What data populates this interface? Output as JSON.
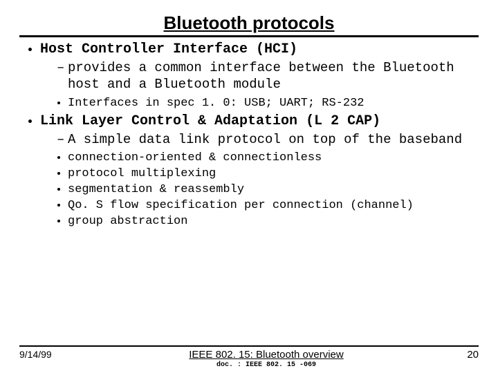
{
  "title": "Bluetooth protocols",
  "sections": [
    {
      "heading": "Host Controller Interface (HCI)",
      "dash": [
        "provides a common interface between the Bluetooth host and a Bluetooth module"
      ],
      "dot": [
        "Interfaces in spec 1. 0: USB; UART; RS-232"
      ]
    },
    {
      "heading": "Link Layer Control & Adaptation (L 2 CAP)",
      "dash": [
        "A simple data link protocol on top of the baseband"
      ],
      "dot": [
        "connection-oriented & connectionless",
        "protocol multiplexing",
        "segmentation & reassembly",
        "Qo. S flow specification per connection (channel)",
        "group abstraction"
      ]
    }
  ],
  "footer": {
    "date": "9/14/99",
    "center_title": "IEEE 802. 15: Bluetooth overview",
    "doc": "doc. : IEEE 802. 15 -069",
    "page": "20"
  }
}
